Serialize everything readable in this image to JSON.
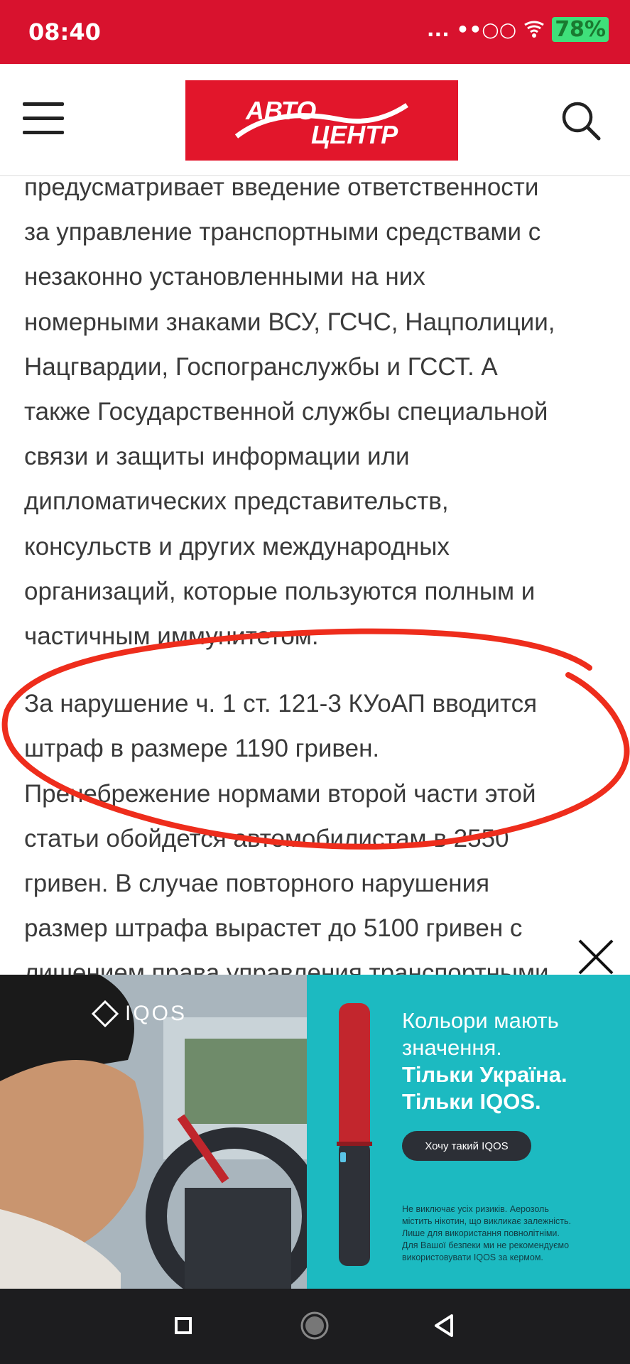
{
  "status_bar": {
    "time": "08:40",
    "indicators": "... ••○○",
    "battery": "78%"
  },
  "header": {
    "logo_line1": "АВТО",
    "logo_line2": "ЦЕНТР",
    "menu_icon": "hamburger-menu-icon",
    "search_icon": "search-icon",
    "brand_color": "#e2162b"
  },
  "article": {
    "paragraph1": [
      "предусматривает введение ответственности",
      "за управление транспортными средствами с",
      "незаконно установленными на них",
      "номерными знаками ВСУ, ГСЧС, Нацполиции,",
      "Нацгвардии, Госпогранслужбы и ГССТ. А",
      "также Государственной службы специальной",
      "связи и защиты информации или",
      "дипломатических представительств,",
      "консульств и других международных",
      "организаций, которые пользуются полным и",
      "частичным иммунитетом."
    ],
    "paragraph2": [
      "За нарушение ч. 1 ст. 121-3 КУоАП вводится",
      "штраф в размере 1190 гривен.",
      "Пренебрежение нормами второй части этой",
      "статьи обойдется автомобилистам в 2550",
      "гривен. В случае повторного нарушения",
      "размер штрафа вырастет до 5100 гривен с",
      "лишением права управления транспортными"
    ]
  },
  "ad": {
    "brand": "IQOS",
    "headline": [
      "Кольори мають",
      "значення."
    ],
    "headline_bold": [
      "Тільки Україна.",
      "Тільки IQOS."
    ],
    "button_label": "Хочу такий IQOS",
    "disclaimer": [
      "Не виключає усіх ризиків. Аерозоль",
      "містить нікотин, що викликає залежність.",
      "Лише для використання повнолітніми.",
      "Для Вашої безпеки ми не рекомендуємо",
      "використовувати IQOS за кермом."
    ],
    "close_icon": "close-icon",
    "bg_color": "#1cbac1"
  },
  "nav_bar": {
    "recents_icon": "square-recents-icon",
    "home_icon": "circle-home-icon",
    "back_icon": "triangle-back-icon"
  }
}
